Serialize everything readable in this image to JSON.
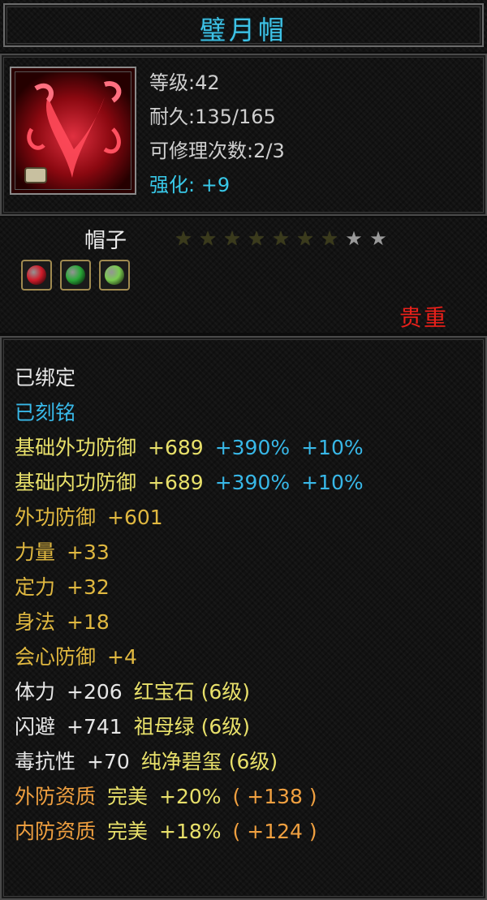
{
  "item_name": "璧月帽",
  "info": {
    "level_label": "等级:",
    "level_value": "42",
    "durability_label": "耐久:",
    "durability_value": "135/165",
    "repair_label": "可修理次数:",
    "repair_value": "2/3",
    "enhance_label": "强化: ",
    "enhance_value": "+9"
  },
  "item_type": "帽子",
  "stars": {
    "total": 9,
    "filled": 7
  },
  "gem_slots": [
    {
      "icon": "red-gem-icon",
      "color": "#d01c2a"
    },
    {
      "icon": "green-gem-icon",
      "color": "#2aa838"
    },
    {
      "icon": "jade-gem-icon",
      "color": "#7acb50"
    }
  ],
  "rarity": "贵重",
  "colors": {
    "title": "#3ec2e6",
    "white": "#e6e6e6",
    "cyan": "#38b8e8",
    "gold": "#e0b840",
    "yellow": "#e8e06a",
    "orange": "#f0a040",
    "red": "#e8201a"
  },
  "attributes": [
    {
      "parts": [
        {
          "text": "已绑定",
          "color": "white"
        }
      ]
    },
    {
      "parts": [
        {
          "text": "已刻铭",
          "color": "cyan"
        }
      ]
    },
    {
      "parts": [
        {
          "text": "基础外功防御",
          "color": "yellow"
        },
        {
          "text": "+689",
          "color": "yellow"
        },
        {
          "text": "+390%",
          "color": "cyan"
        },
        {
          "text": "+10%",
          "color": "cyan"
        }
      ]
    },
    {
      "parts": [
        {
          "text": "基础内功防御",
          "color": "yellow"
        },
        {
          "text": "+689",
          "color": "yellow"
        },
        {
          "text": "+390%",
          "color": "cyan"
        },
        {
          "text": "+10%",
          "color": "cyan"
        }
      ]
    },
    {
      "parts": [
        {
          "text": "外功防御",
          "color": "gold"
        },
        {
          "text": "+601",
          "color": "gold"
        }
      ]
    },
    {
      "parts": [
        {
          "text": "力量",
          "color": "gold"
        },
        {
          "text": "+33",
          "color": "gold"
        }
      ]
    },
    {
      "parts": [
        {
          "text": "定力",
          "color": "gold"
        },
        {
          "text": "+32",
          "color": "gold"
        }
      ]
    },
    {
      "parts": [
        {
          "text": "身法",
          "color": "gold"
        },
        {
          "text": "+18",
          "color": "gold"
        }
      ]
    },
    {
      "parts": [
        {
          "text": "会心防御",
          "color": "gold"
        },
        {
          "text": "+4",
          "color": "gold"
        }
      ]
    },
    {
      "parts": [
        {
          "text": "体力",
          "color": "white"
        },
        {
          "text": "+206",
          "color": "white"
        },
        {
          "text": "红宝石 (6级)",
          "color": "yellow"
        }
      ]
    },
    {
      "parts": [
        {
          "text": "闪避",
          "color": "white"
        },
        {
          "text": "+741",
          "color": "white"
        },
        {
          "text": "祖母绿 (6级)",
          "color": "yellow"
        }
      ]
    },
    {
      "parts": [
        {
          "text": "毒抗性",
          "color": "white"
        },
        {
          "text": "+70",
          "color": "white"
        },
        {
          "text": "纯净碧玺 (6级)",
          "color": "yellow"
        }
      ]
    },
    {
      "parts": [
        {
          "text": "外防资质",
          "color": "orange"
        },
        {
          "text": "完美",
          "color": "yellow"
        },
        {
          "text": "+20%",
          "color": "yellow"
        },
        {
          "text": "( +138 )",
          "color": "orange"
        }
      ]
    },
    {
      "parts": [
        {
          "text": "内防资质",
          "color": "orange"
        },
        {
          "text": "完美",
          "color": "yellow"
        },
        {
          "text": "+18%",
          "color": "yellow"
        },
        {
          "text": "( +124 )",
          "color": "orange"
        }
      ]
    }
  ]
}
